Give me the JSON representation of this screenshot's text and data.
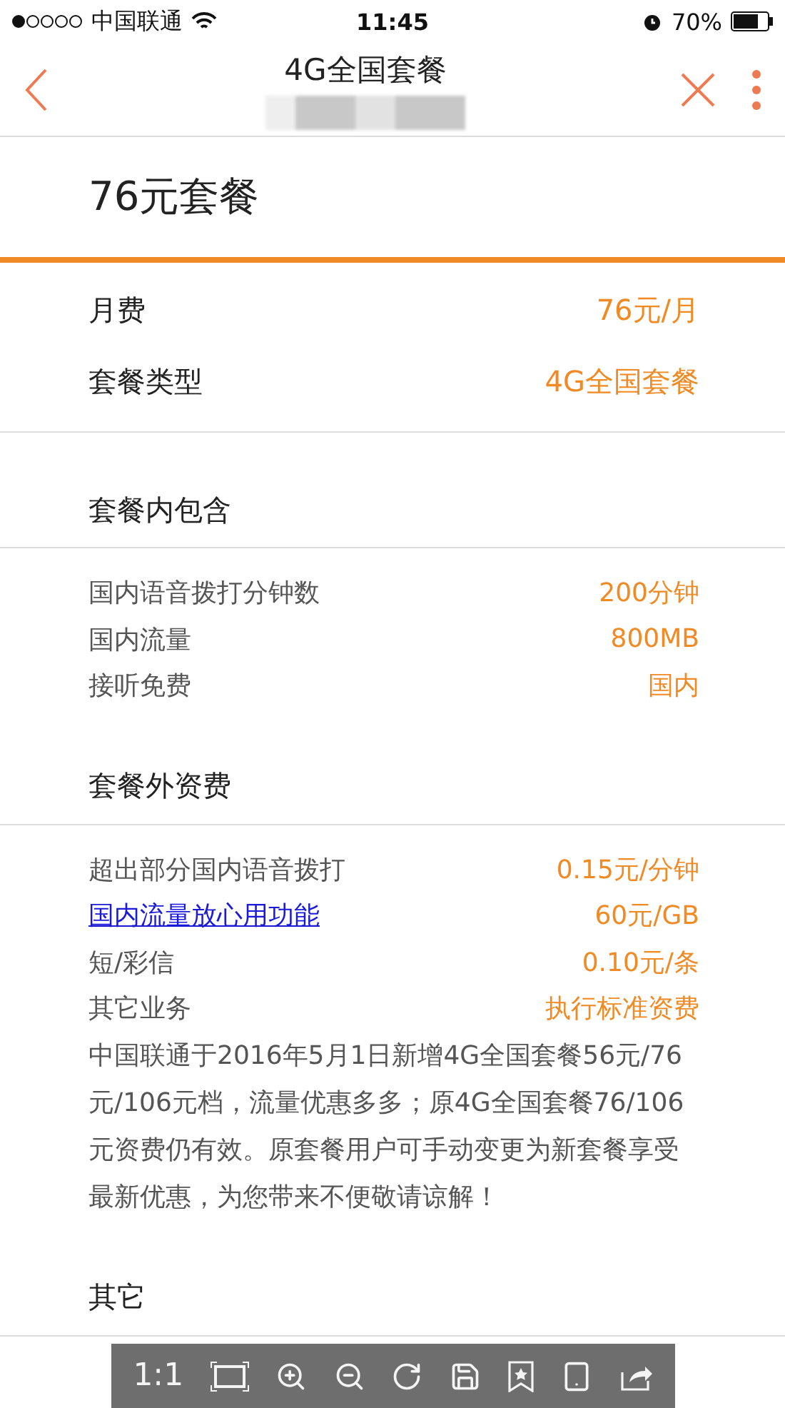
{
  "status_bar": {
    "carrier": "中国联通",
    "time": "11:45",
    "battery": "70%"
  },
  "nav": {
    "title": "4G全国套餐"
  },
  "plan": {
    "title": "76元套餐"
  },
  "summary": [
    {
      "label": "月费",
      "value": "76元/月"
    },
    {
      "label": "套餐类型",
      "value": "4G全国套餐"
    }
  ],
  "sections": [
    {
      "title": "套餐内包含",
      "rows": [
        {
          "kind": "text",
          "label": "国内语音拨打分钟数",
          "value": "200分钟"
        },
        {
          "kind": "text",
          "label": "国内流量",
          "value": "800MB"
        },
        {
          "kind": "text",
          "label": "接听免费",
          "value": "国内"
        }
      ]
    },
    {
      "title": "套餐外资费",
      "rows": [
        {
          "kind": "text",
          "label": "超出部分国内语音拨打",
          "value": "0.15元/分钟"
        },
        {
          "kind": "link",
          "label": "国内流量放心用功能",
          "value": "60元/GB"
        },
        {
          "kind": "text",
          "label": "短/彩信",
          "value": "0.10元/条"
        },
        {
          "kind": "text",
          "label": "其它业务",
          "value": "执行标准资费"
        }
      ],
      "note": "中国联通于2016年5月1日新增4G全国套餐56元/76元/106元档，流量优惠多多；原4G全国套餐76/106元资费仍有效。原套餐用户可手动变更为新套餐享受最新优惠，为您带来不便敬请谅解！"
    },
    {
      "title": "其它"
    }
  ],
  "viewer_toolbar": {
    "zoom_label": "1:1"
  }
}
